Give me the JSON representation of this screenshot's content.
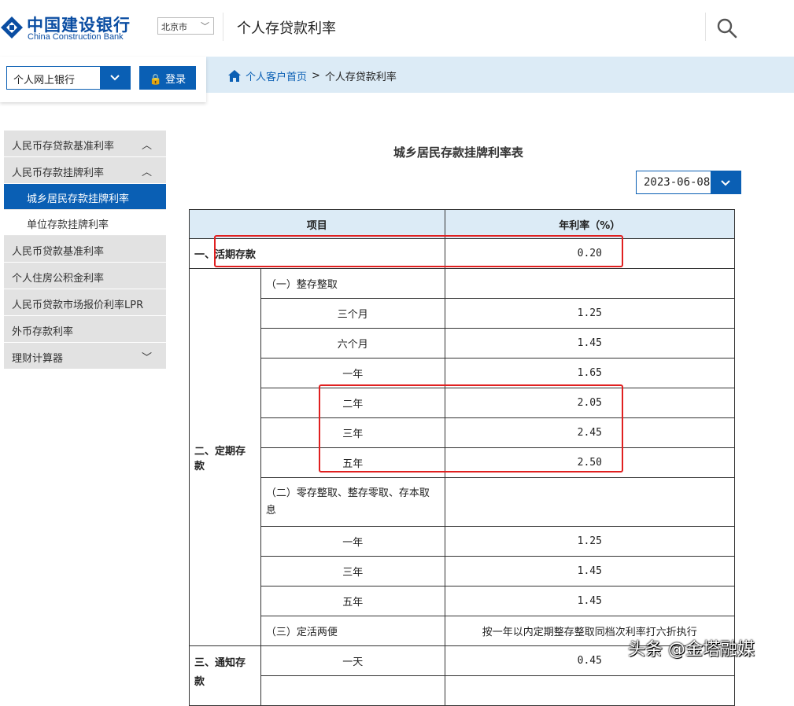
{
  "header": {
    "logo_cn": "中国建设银行",
    "logo_en": "China Construction Bank",
    "city": "北京市",
    "page_title": "个人存贷款利率",
    "brand_color": "#0a5fb4"
  },
  "subheader": {
    "bank_select": "个人网上银行",
    "login": "登录",
    "breadcrumb_home": "个人客户首页",
    "breadcrumb_sep": ">",
    "breadcrumb_current": "个人存贷款利率"
  },
  "sidebar": {
    "items": [
      {
        "label": "人民币存贷款基准利率"
      },
      {
        "label": "人民币存款挂牌利率"
      },
      {
        "label": "城乡居民存款挂牌利率"
      },
      {
        "label": "单位存款挂牌利率"
      },
      {
        "label": "人民币贷款基准利率"
      },
      {
        "label": "个人住房公积金利率"
      },
      {
        "label": "人民币贷款市场报价利率LPR"
      },
      {
        "label": "外币存款利率"
      },
      {
        "label": "理财计算器"
      }
    ]
  },
  "main": {
    "table_title": "城乡居民存款挂牌利率表",
    "date": "2023-06-08",
    "headers": [
      "项目",
      "年利率（%）"
    ],
    "rows": {
      "demand": {
        "label": "一、活期存款",
        "rate": "0.20"
      },
      "time": {
        "label": "二、定期存款"
      },
      "lump": {
        "label": "（一）整存整取"
      },
      "lump_3m": {
        "label": "三个月",
        "rate": "1.25"
      },
      "lump_6m": {
        "label": "六个月",
        "rate": "1.45"
      },
      "lump_1y": {
        "label": "一年",
        "rate": "1.65"
      },
      "lump_2y": {
        "label": "二年",
        "rate": "2.05"
      },
      "lump_3y": {
        "label": "三年",
        "rate": "2.45"
      },
      "lump_5y": {
        "label": "五年",
        "rate": "2.50"
      },
      "installment": {
        "label": "（二）零存整取、整存零取、存本取息"
      },
      "inst_1y": {
        "label": "一年",
        "rate": "1.25"
      },
      "inst_3y": {
        "label": "三年",
        "rate": "1.45"
      },
      "inst_5y": {
        "label": "五年",
        "rate": "1.45"
      },
      "flexible": {
        "label": "（三）定活两便",
        "rate": "按一年以内定期整存整取同档次利率打六折执行"
      },
      "notice": {
        "label": "三、通知存款"
      },
      "notice_1d": {
        "label": "一天",
        "rate": "0.45"
      }
    }
  },
  "watermark": "头条 @金塔融媒"
}
